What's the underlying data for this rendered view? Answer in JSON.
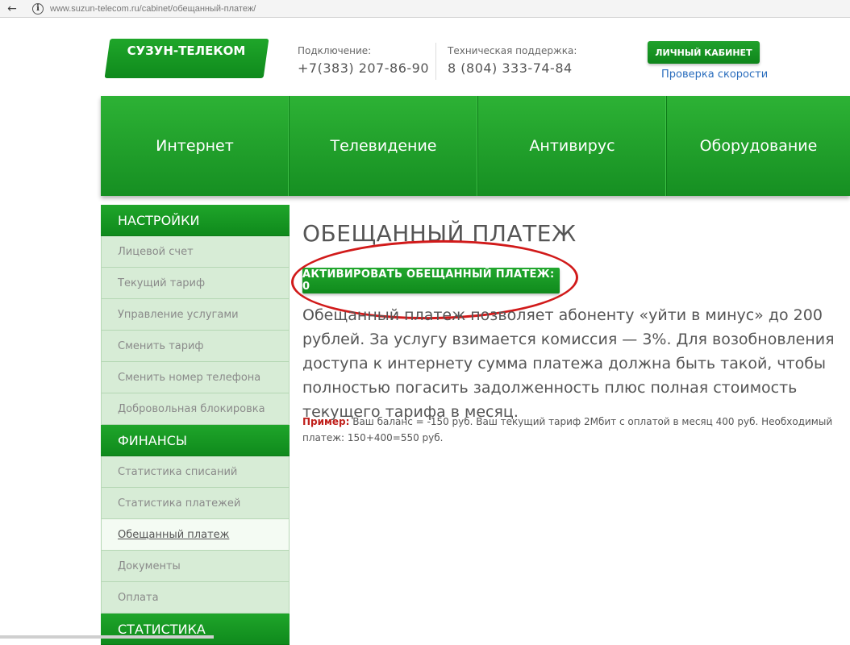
{
  "browser": {
    "back_glyph": "←",
    "info_glyph": "i",
    "url": "www.suzun-telecom.ru/cabinet/обещанный-платеж/"
  },
  "header": {
    "logo_text": "СУЗУН-ТЕЛЕКОМ",
    "contacts": [
      {
        "label": "Подключение:",
        "phone": "+7(383) 207-86-90"
      },
      {
        "label": "Техническая поддержка:",
        "phone": "8 (804) 333-74-84"
      }
    ],
    "cabinet_button": "ЛИЧНЫЙ КАБИНЕТ",
    "speed_link": "Проверка скорости"
  },
  "nav": {
    "items": [
      "Интернет",
      "Телевидение",
      "Антивирус",
      "Оборудование"
    ]
  },
  "sidebar": {
    "sections": [
      {
        "title": "НАСТРОЙКИ",
        "items": [
          "Лицевой счет",
          "Текущий тариф",
          "Управление услугами",
          "Сменить тариф",
          "Сменить номер телефона",
          "Добровольная блокировка"
        ]
      },
      {
        "title": "ФИНАНСЫ",
        "items": [
          "Статистика списаний",
          "Статистика платежей",
          "Обещанный платеж",
          "Документы",
          "Оплата"
        ]
      },
      {
        "title": "СТАТИСТИКА",
        "items": []
      }
    ],
    "active_item": "Обещанный платеж"
  },
  "main": {
    "title": "ОБЕЩАННЫЙ ПЛАТЕЖ",
    "activate_button": "АКТИВИРОВАТЬ ОБЕЩАННЫЙ ПЛАТЕЖ: 0",
    "description": "Обещанный платеж позволяет абоненту «уйти в минус» до 200 рублей. За услугу взимается комиссия — 3%.  Для возобновления доступа к интернету сумма платежа должна быть такой, чтобы полностью погасить задолженность плюс полная стоимость текущего тарифа в месяц.",
    "example_label": "Пример:",
    "example_text": "Ваш баланс = -150 руб. Ваш текущий тариф 2Мбит с оплатой в месяц 400 руб. Необходимый платеж:  150+400=550 руб."
  },
  "colors": {
    "brand_green": "#1a9a26",
    "annotation_red": "#d11a1a",
    "link_blue": "#2a6dbd"
  }
}
